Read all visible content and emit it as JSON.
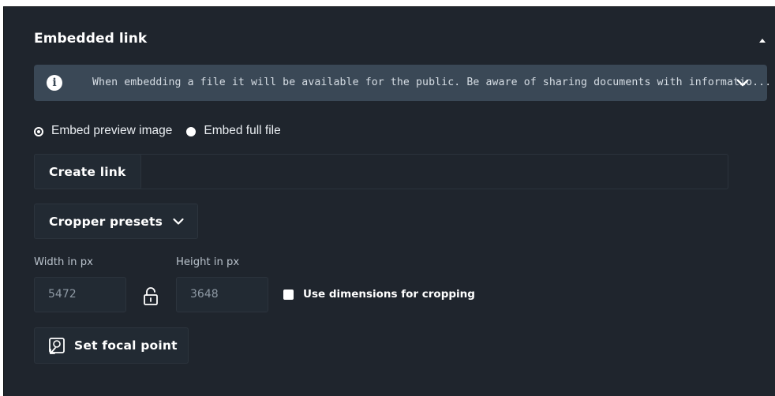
{
  "section": {
    "title": "Embedded link",
    "collapse_icon": "caret-up-icon"
  },
  "info": {
    "icon": "info-icon",
    "icon_glyph": "i",
    "text": "When embedding a file it will be available for the public. Be aware of sharing documents with informatio...",
    "expand_icon": "chevron-down-icon"
  },
  "embed_options": {
    "preview_label": "Embed preview image",
    "full_label": "Embed full file",
    "selected": "Embed preview image"
  },
  "link": {
    "create_label": "Create link",
    "value": ""
  },
  "cropper": {
    "presets_label": "Cropper presets",
    "icon": "chevron-down-icon"
  },
  "dimensions": {
    "width_label": "Width in px",
    "height_label": "Height in px",
    "width_value": "5472",
    "height_value": "3648",
    "lock_icon": "unlock-icon",
    "use_for_cropping_label": "Use dimensions for cropping",
    "use_for_cropping_checked": false
  },
  "focal": {
    "label": "Set focal point",
    "icon": "focal-point-icon"
  },
  "colors": {
    "panel_bg": "#1f252d",
    "info_bg": "#3a4856",
    "text": "#e9edf1"
  }
}
